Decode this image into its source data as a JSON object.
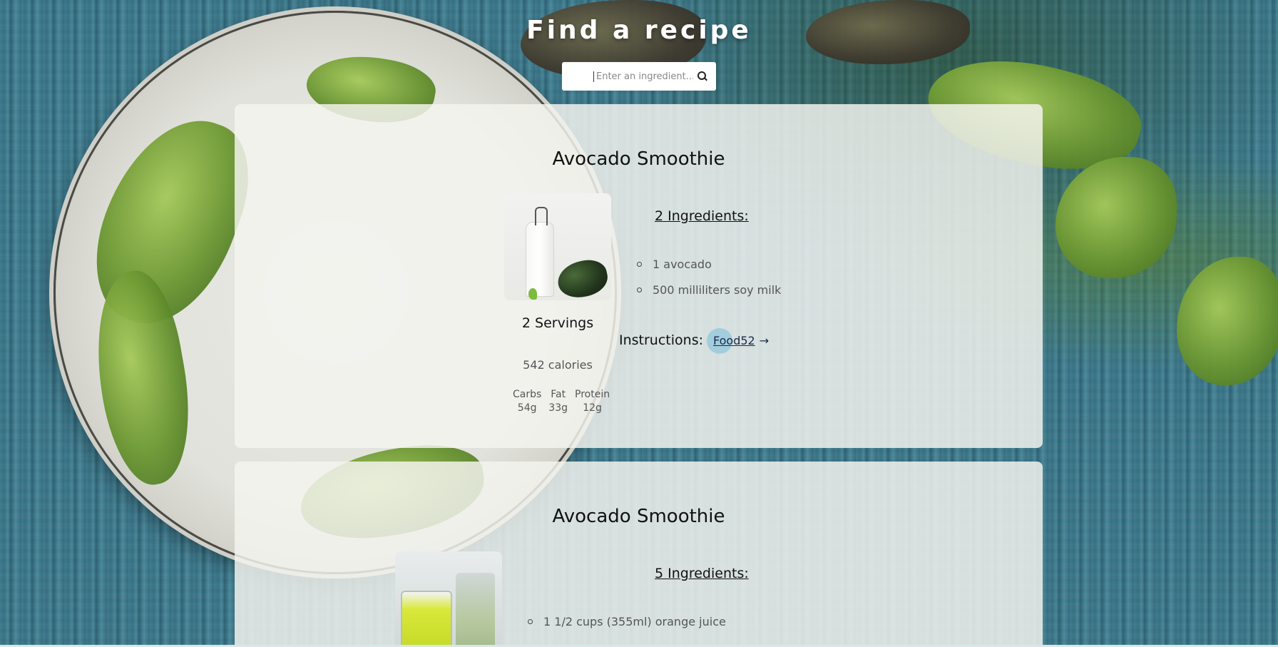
{
  "header": {
    "title": "Find a recipe"
  },
  "search": {
    "placeholder": "Enter an ingredient..."
  },
  "recipes": [
    {
      "title": "Avocado Smoothie",
      "image_icon": "milk-bottle-avocado-photo",
      "ingredients_heading": "2 Ingredients:",
      "ingredients": [
        "1 avocado",
        "500 milliliters soy milk"
      ],
      "servings": "2 Servings",
      "calories": "542 calories",
      "macros": [
        {
          "label": "Carbs",
          "value": "54g"
        },
        {
          "label": "Fat",
          "value": "33g"
        },
        {
          "label": "Protein",
          "value": "12g"
        }
      ],
      "instructions_label": "Instructions:",
      "source_link": "Food52",
      "source_arrow": "→"
    },
    {
      "title": "Avocado Smoothie",
      "image_icon": "green-smoothie-glass-photo",
      "ingredients_heading": "5 Ingredients:",
      "ingredients": [
        "1 1/2 cups (355ml) orange juice"
      ]
    }
  ]
}
